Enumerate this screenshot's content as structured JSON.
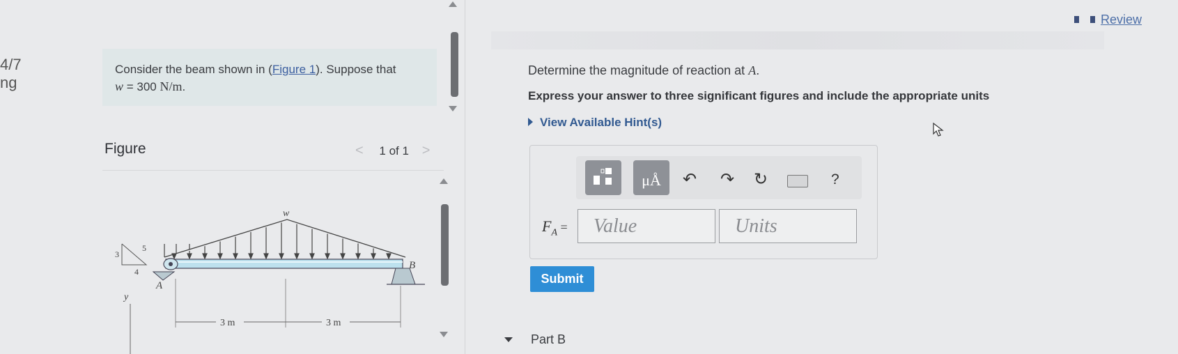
{
  "left_edge": {
    "line1": "4/7",
    "line2": "ng"
  },
  "problem": {
    "prefix": "Consider the beam shown in (",
    "figure_link": "Figure 1",
    "suffix": "). Suppose that",
    "w_var": "w",
    "w_eq": " = 300 ",
    "w_unit": "N/m",
    "end": "."
  },
  "figure": {
    "title": "Figure",
    "pager": "1 of 1",
    "prev": "<",
    "next": ">",
    "labels": {
      "w": "w",
      "three": "3",
      "four": "4",
      "five": "5",
      "a": "A",
      "b": "B",
      "y": "y",
      "dim1": "3 m",
      "dim2": "3 m"
    }
  },
  "right": {
    "review": "Review",
    "question_prefix": "Determine the magnitude of reaction at ",
    "question_var": "A",
    "question_end": ".",
    "instruction": "Express your answer to three significant figures and include the appropriate units",
    "hints": "View Available Hint(s)",
    "toolbar": {
      "units_btn": "μÅ",
      "help": "?"
    },
    "answer_label": "F",
    "answer_sub": "A",
    "answer_eq": " =",
    "value_placeholder": "Value",
    "units_placeholder": "Units",
    "submit": "Submit",
    "part_b": "Part B"
  },
  "colors": {
    "accent": "#2e8ed6",
    "link": "#325a91",
    "problem_bg": "#dfe7e8"
  }
}
